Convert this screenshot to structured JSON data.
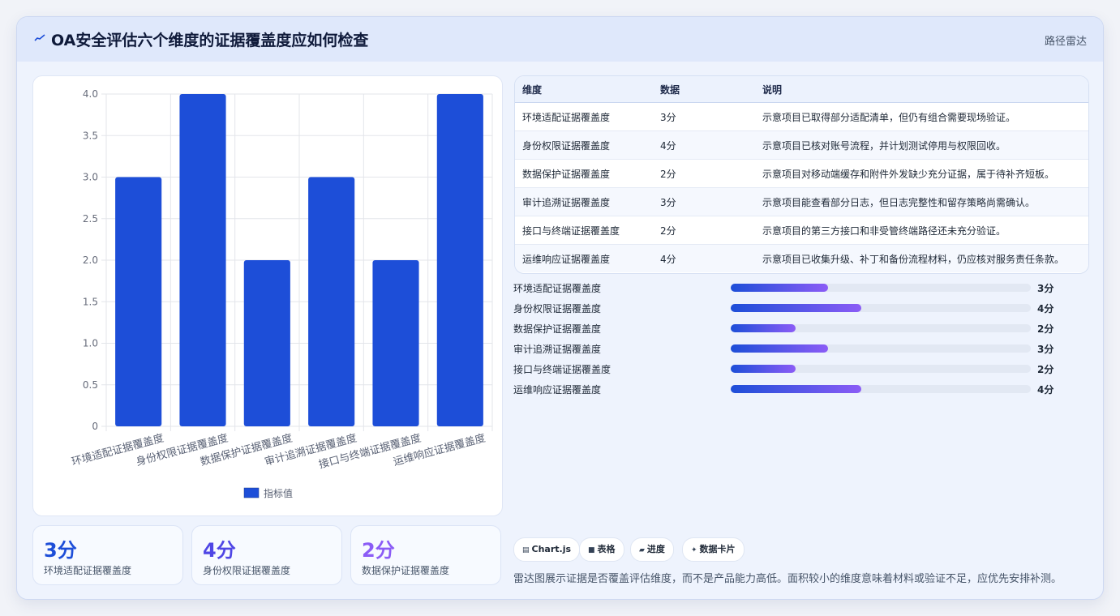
{
  "header": {
    "icon": "sparkline-icon",
    "title": "OA安全评估六个维度的证据覆盖度应如何检查",
    "badge": "路径雷达"
  },
  "colors": {
    "accent": "#1d4ed8",
    "accent_end": "#8b5cf6",
    "kpi_colors": [
      "#1d4ed8",
      "#4f46e5",
      "#8b5cf6"
    ]
  },
  "chart_data": {
    "type": "bar",
    "categories": [
      "环境适配证据覆盖度",
      "身份权限证据覆盖度",
      "数据保护证据覆盖度",
      "审计追溯证据覆盖度",
      "接口与终端证据覆盖度",
      "运维响应证据覆盖度"
    ],
    "series": [
      {
        "name": "指标值",
        "values": [
          3,
          4,
          2,
          3,
          2,
          4
        ]
      }
    ],
    "ylim": [
      0,
      4
    ],
    "yticks": [
      "0",
      "0.5",
      "1.0",
      "1.5",
      "2.0",
      "2.5",
      "3.0",
      "3.5",
      "4.0"
    ],
    "grid": true,
    "legend": "bottom",
    "color": "#1d4ed8"
  },
  "table": {
    "headers": [
      "维度",
      "数据",
      "说明"
    ],
    "rows": [
      [
        "环境适配证据覆盖度",
        "3分",
        "示意项目已取得部分适配清单，但仍有组合需要现场验证。"
      ],
      [
        "身份权限证据覆盖度",
        "4分",
        "示意项目已核对账号流程，并计划测试停用与权限回收。"
      ],
      [
        "数据保护证据覆盖度",
        "2分",
        "示意项目对移动端缓存和附件外发缺少充分证据，属于待补齐短板。"
      ],
      [
        "审计追溯证据覆盖度",
        "3分",
        "示意项目能查看部分日志，但日志完整性和留存策略尚需确认。"
      ],
      [
        "接口与终端证据覆盖度",
        "2分",
        "示意项目的第三方接口和非受管终端路径还未充分验证。"
      ],
      [
        "运维响应证据覆盖度",
        "4分",
        "示意项目已收集升级、补丁和备份流程材料，仍应核对服务责任条款。"
      ]
    ]
  },
  "progress": [
    {
      "label": "环境适配证据覆盖度",
      "value": "3分",
      "fraction": 0.325
    },
    {
      "label": "身份权限证据覆盖度",
      "value": "4分",
      "fraction": 0.435
    },
    {
      "label": "数据保护证据覆盖度",
      "value": "2分",
      "fraction": 0.216
    },
    {
      "label": "审计追溯证据覆盖度",
      "value": "3分",
      "fraction": 0.325
    },
    {
      "label": "接口与终端证据覆盖度",
      "value": "2分",
      "fraction": 0.216
    },
    {
      "label": "运维响应证据覆盖度",
      "value": "4分",
      "fraction": 0.435
    }
  ],
  "kpis": [
    {
      "value": "3分",
      "label": "环境适配证据覆盖度"
    },
    {
      "value": "4分",
      "label": "身份权限证据覆盖度"
    },
    {
      "value": "2分",
      "label": "数据保护证据覆盖度"
    }
  ],
  "chips": [
    {
      "icon": "chart-icon",
      "glyph": "▤",
      "label": "Chart.js"
    },
    {
      "icon": "table-icon",
      "glyph": "■",
      "label": "表格"
    },
    {
      "icon": "progress-icon",
      "glyph": "▰",
      "label": "进度"
    },
    {
      "icon": "sparkle-icon",
      "glyph": "✦",
      "label": "数据卡片"
    }
  ],
  "note": "雷达图展示证据是否覆盖评估维度，而不是产品能力高低。面积较小的维度意味着材料或验证不足，应优先安排补测。"
}
